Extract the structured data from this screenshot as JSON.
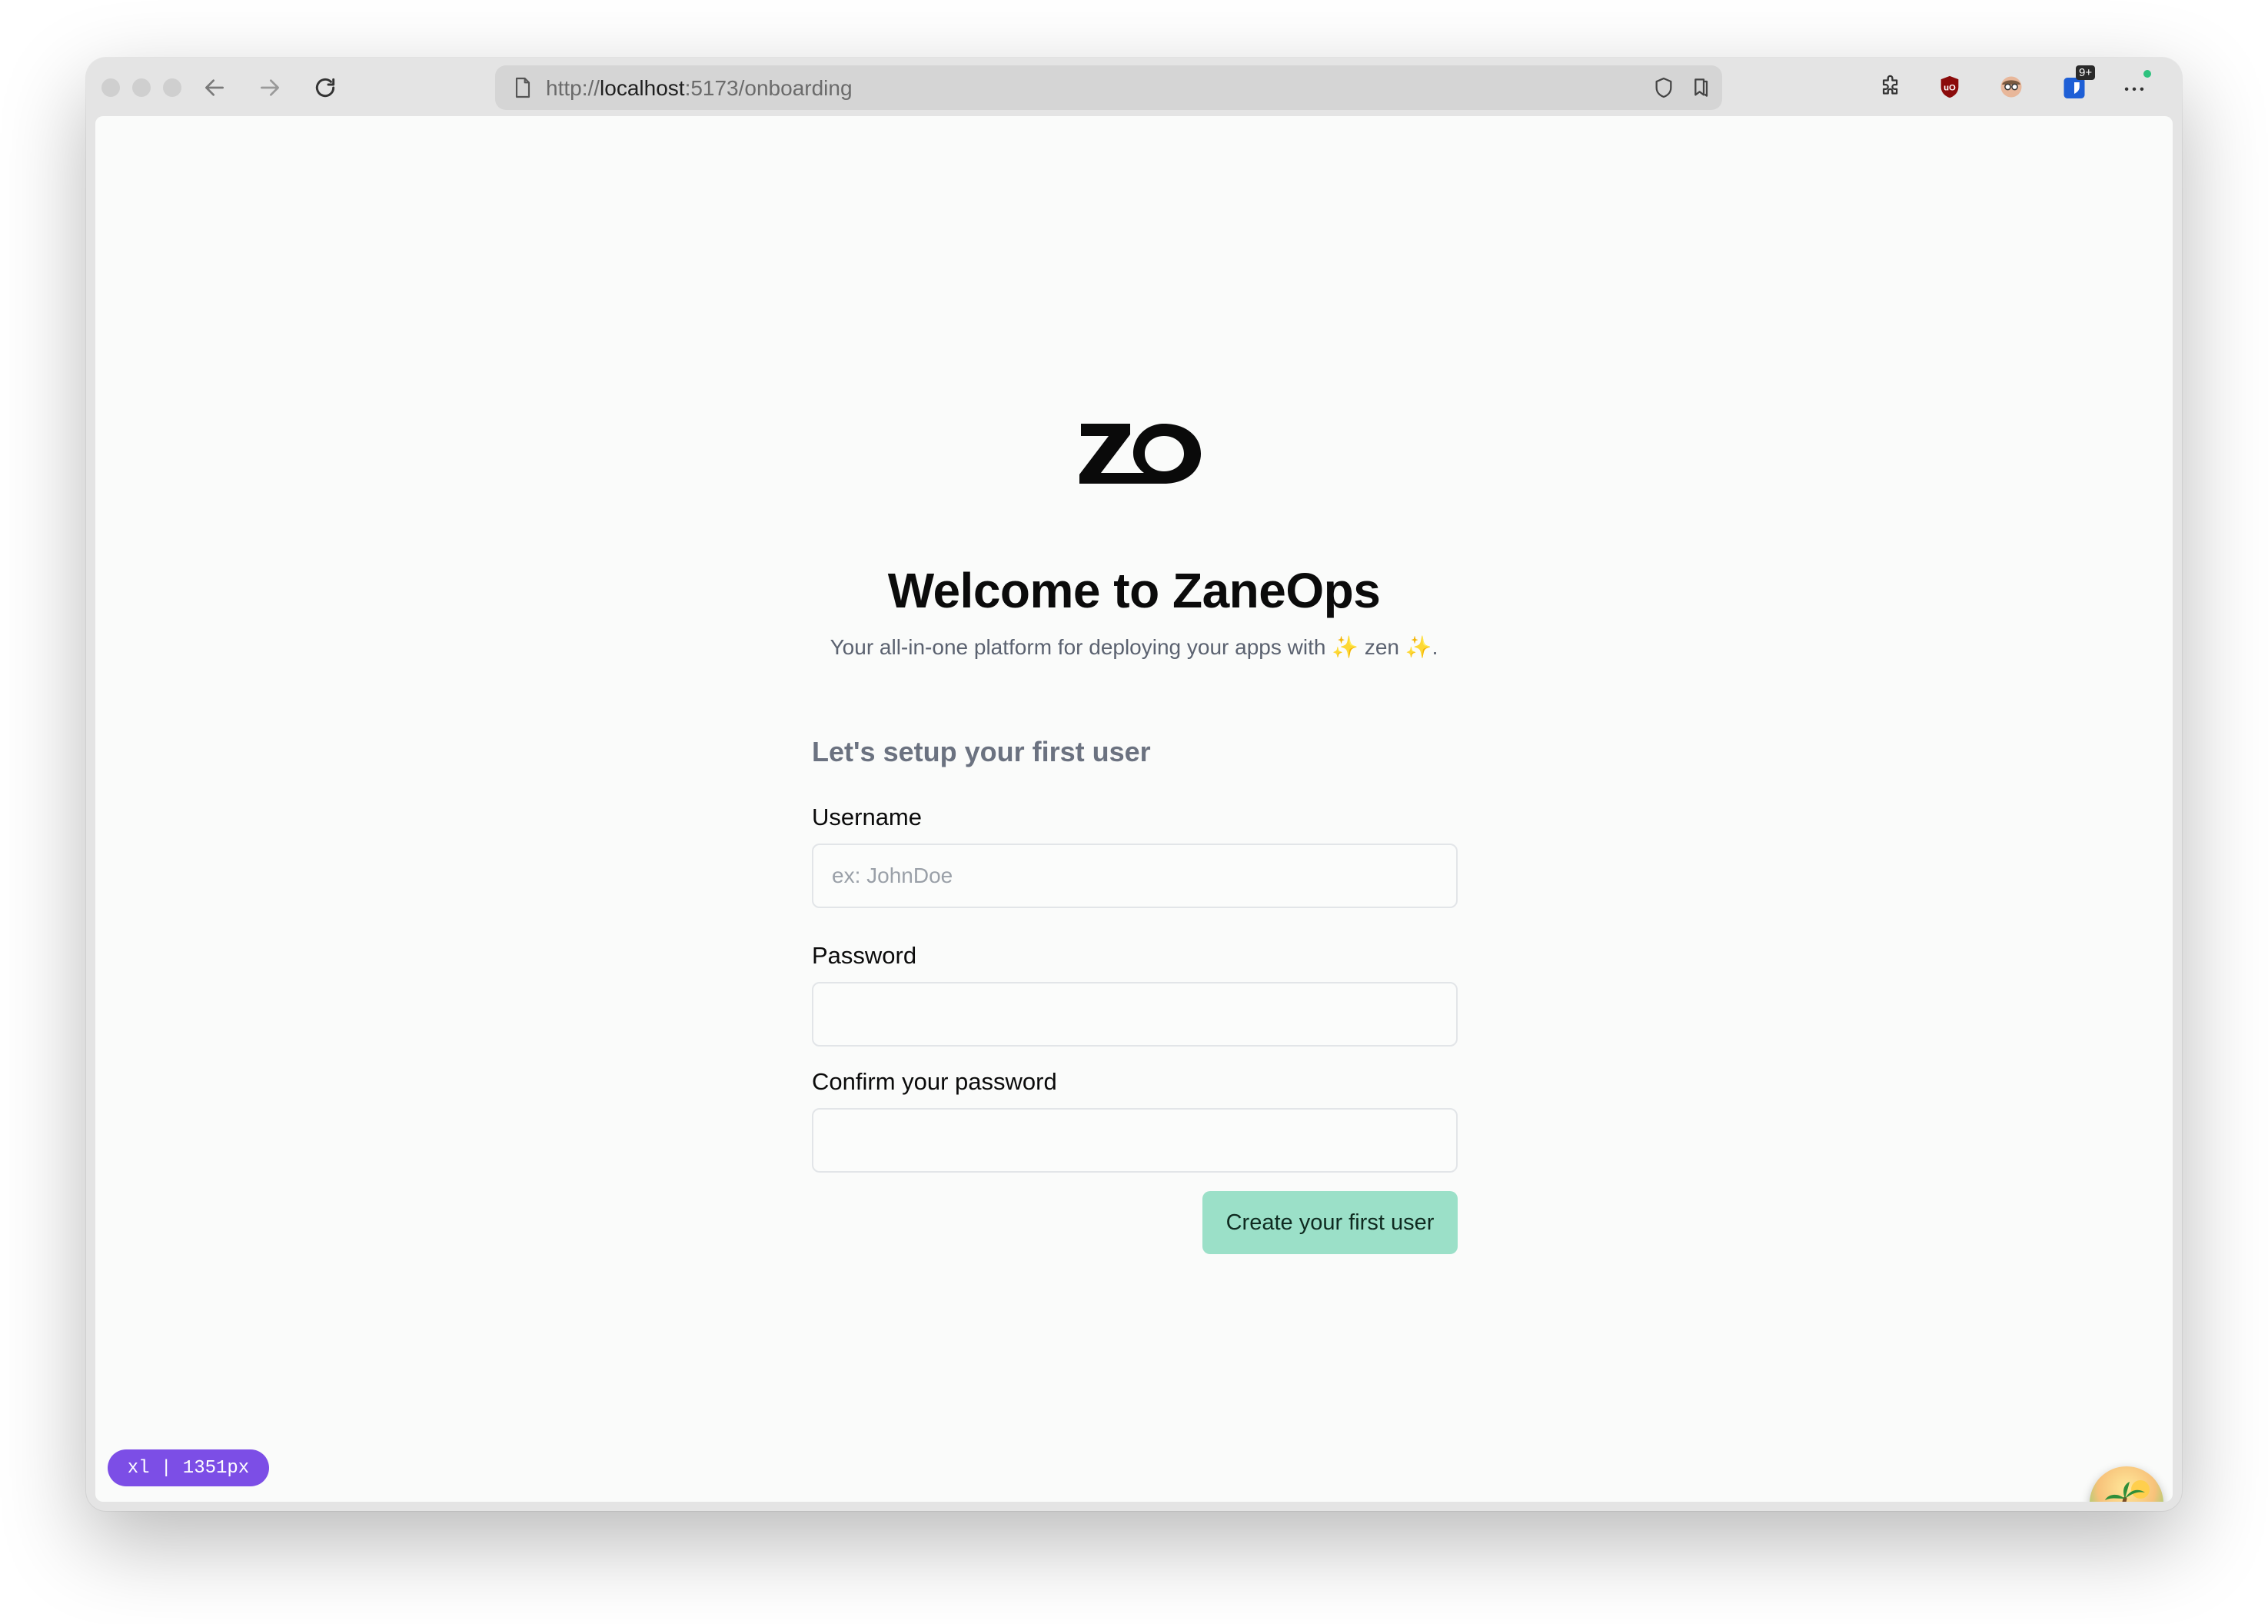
{
  "browser": {
    "url_scheme": "http://",
    "url_host": "localhost",
    "url_path": ":5173/onboarding",
    "extension_badge": "9+"
  },
  "page": {
    "logo_text": "ZO",
    "title": "Welcome to ZaneOps",
    "subtitle": "Your all-in-one platform for deploying your apps with ✨ zen ✨.",
    "section_title": "Let's setup your first user",
    "username_label": "Username",
    "username_placeholder": "ex: JohnDoe",
    "password_label": "Password",
    "confirm_label": "Confirm your password",
    "submit_label": "Create your first user"
  },
  "debug_badge": "xl | 1351px",
  "colors": {
    "accent": "#9be0c8",
    "badge": "#7c4ee6",
    "background": "#fafbfa"
  }
}
